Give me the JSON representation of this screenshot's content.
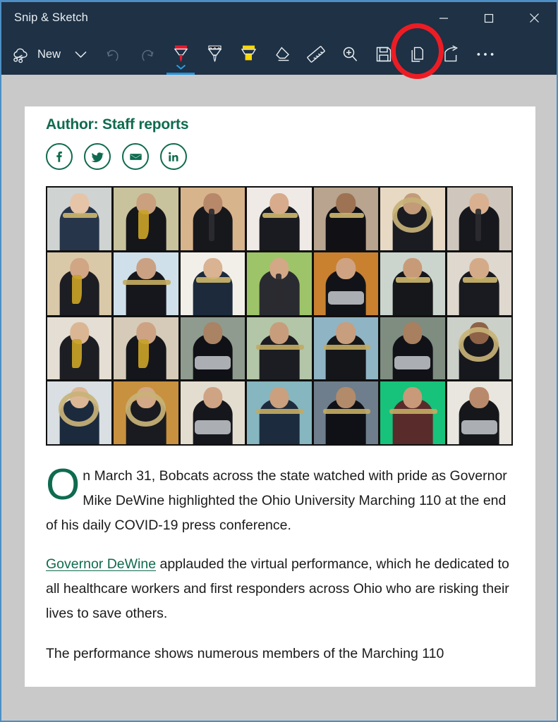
{
  "window": {
    "title": "Snip & Sketch",
    "controls": [
      {
        "name": "minimize",
        "label": "–"
      },
      {
        "name": "maximize",
        "label": "□"
      },
      {
        "name": "close",
        "label": "✕"
      }
    ],
    "accent_border_color": "#4d8fc4",
    "chrome_color": "#1e3145"
  },
  "toolbar": {
    "new_label": "New",
    "new_icon": "snip-scissors-cloud-icon",
    "new_dropdown_icon": "chevron-down-icon",
    "tools": [
      {
        "name": "undo",
        "icon": "undo-arrow-icon",
        "enabled": false,
        "selected": false
      },
      {
        "name": "redo",
        "icon": "redo-arrow-icon",
        "enabled": false,
        "selected": false
      },
      {
        "name": "ballpoint-pen",
        "icon": "ballpoint-pen-icon",
        "enabled": true,
        "selected": true,
        "color": "#e8192c"
      },
      {
        "name": "pencil",
        "icon": "pencil-icon",
        "enabled": true,
        "selected": false,
        "color": "#1b1b1b"
      },
      {
        "name": "highlighter",
        "icon": "highlighter-icon",
        "enabled": true,
        "selected": false,
        "color": "#ffd800"
      },
      {
        "name": "eraser",
        "icon": "eraser-icon",
        "enabled": true,
        "selected": false
      },
      {
        "name": "ruler",
        "icon": "ruler-icon",
        "enabled": true,
        "selected": false
      },
      {
        "name": "crop",
        "icon": "magnifier-plus-icon",
        "enabled": true,
        "selected": false
      },
      {
        "name": "save",
        "icon": "floppy-disk-save-icon",
        "enabled": true,
        "selected": false,
        "highlighted": true
      },
      {
        "name": "copy",
        "icon": "copy-pages-icon",
        "enabled": true,
        "selected": false
      },
      {
        "name": "share",
        "icon": "share-arrow-icon",
        "enabled": true,
        "selected": false
      },
      {
        "name": "see-more",
        "icon": "ellipsis-icon",
        "enabled": true,
        "selected": false
      }
    ],
    "selection_accent_color": "#2095e0"
  },
  "annotation": {
    "shape": "ellipse",
    "color": "#ed1c24",
    "targets": "save-button"
  },
  "canvas": {
    "background_color": "#c9c9c9"
  },
  "snip": {
    "author_line": "Author: Staff reports",
    "brand_color": "#0f6b4f",
    "social_buttons": [
      {
        "name": "facebook",
        "icon": "facebook-icon",
        "label": "f"
      },
      {
        "name": "twitter",
        "icon": "twitter-bird-icon",
        "label": "t"
      },
      {
        "name": "email",
        "icon": "envelope-icon",
        "label": "e"
      },
      {
        "name": "linkedin",
        "icon": "linkedin-icon",
        "label": "in"
      }
    ],
    "photo_grid": {
      "name": "marching-110-virtual-performance-grid",
      "rows": 4,
      "columns": 7,
      "cells": [
        {
          "bg": "#cfd3d2",
          "skin": "#e6c4a8",
          "shirt": "#27354a",
          "instrument": "trumpet",
          "ix": 1
        },
        {
          "bg": "#c8c39c",
          "skin": "#caa07e",
          "shirt": "#15161a",
          "instrument": "saxophone",
          "ix": 2
        },
        {
          "bg": "#d8b48c",
          "skin": "#b8886a",
          "shirt": "#17181c",
          "instrument": "clarinet",
          "ix": 3
        },
        {
          "bg": "#efeae6",
          "skin": "#d7ab8b",
          "shirt": "#1a1b20",
          "instrument": "mellophone",
          "ix": 4
        },
        {
          "bg": "#b8a48f",
          "skin": "#9d7354",
          "shirt": "#101015",
          "instrument": "trumpet",
          "ix": 5
        },
        {
          "bg": "#e7d9c4",
          "skin": "#c39b79",
          "shirt": "#1b1c21",
          "instrument": "sousaphone",
          "ix": 6
        },
        {
          "bg": "#cfc7bd",
          "skin": "#d9b190",
          "shirt": "#17181d",
          "instrument": "clarinet",
          "ix": 7
        },
        {
          "bg": "#d9c9a8",
          "skin": "#d1a684",
          "shirt": "#1d1e23",
          "instrument": "saxophone",
          "ix": 8
        },
        {
          "bg": "#cfe0ea",
          "skin": "#caa183",
          "shirt": "#16171c",
          "instrument": "trombone",
          "ix": 9
        },
        {
          "bg": "#f2efe9",
          "skin": "#d9b392",
          "shirt": "#1c2a3c",
          "instrument": "trumpet",
          "ix": 10
        },
        {
          "bg": "#9ec469",
          "skin": "#d2a887",
          "shirt": "#2a2b30",
          "instrument": "clarinet",
          "ix": 11
        },
        {
          "bg": "#c9812f",
          "skin": "#cfa382",
          "shirt": "#121318",
          "instrument": "drums",
          "ix": 12
        },
        {
          "bg": "#cbd5cd",
          "skin": "#c89b78",
          "shirt": "#16171b",
          "instrument": "trumpet",
          "ix": 13
        },
        {
          "bg": "#dfd8ce",
          "skin": "#d4ab89",
          "shirt": "#1a1b20",
          "instrument": "trumpet",
          "ix": 14
        },
        {
          "bg": "#e4ded4",
          "skin": "#dbb695",
          "shirt": "#1d1e24",
          "instrument": "saxophone",
          "ix": 15
        },
        {
          "bg": "#d5cbb8",
          "skin": "#cda384",
          "shirt": "#15161b",
          "instrument": "saxophone",
          "ix": 16
        },
        {
          "bg": "#8f9b8e",
          "skin": "#a98364",
          "shirt": "#101116",
          "instrument": "drums",
          "ix": 17
        },
        {
          "bg": "#b3c6a8",
          "skin": "#c89d7b",
          "shirt": "#1c1d22",
          "instrument": "trombone",
          "ix": 18
        },
        {
          "bg": "#8fb4c4",
          "skin": "#c79e7e",
          "shirt": "#15161a",
          "instrument": "trombone",
          "ix": 19
        },
        {
          "bg": "#7e8d80",
          "skin": "#a87f5f",
          "shirt": "#111217",
          "instrument": "drums",
          "ix": 20
        },
        {
          "bg": "#cbd0c9",
          "skin": "#8d6246",
          "shirt": "#17181d",
          "instrument": "sousaphone",
          "ix": 21
        },
        {
          "bg": "#d9dfe2",
          "skin": "#dcb795",
          "shirt": "#1b2a3d",
          "instrument": "sousaphone",
          "ix": 22
        },
        {
          "bg": "#c8913f",
          "skin": "#d2a886",
          "shirt": "#1a1b20",
          "instrument": "tuba",
          "ix": 23
        },
        {
          "bg": "#e3ddd0",
          "skin": "#cfa484",
          "shirt": "#16171c",
          "instrument": "drums",
          "ix": 24
        },
        {
          "bg": "#86b6bf",
          "skin": "#caa07f",
          "shirt": "#1d2b3e",
          "instrument": "trombone",
          "ix": 25
        },
        {
          "bg": "#6e7e8c",
          "skin": "#b28b6b",
          "shirt": "#101116",
          "instrument": "trombone",
          "ix": 26
        },
        {
          "bg": "#17c27a",
          "skin": "#c89a79",
          "shirt": "#5a2b2b",
          "instrument": "trombone",
          "ix": 27
        },
        {
          "bg": "#e9e6df",
          "skin": "#b88a6b",
          "shirt": "#16171b",
          "instrument": "drums",
          "ix": 28
        }
      ]
    },
    "paragraph_1_dropcap": "O",
    "paragraph_1": "n March 31, Bobcats across the state watched with pride as Governor Mike DeWine highlighted the Ohio University Marching 110 at the end of his daily COVID-19 press conference.",
    "paragraph_2_link": "Governor DeWine",
    "paragraph_2_rest": " applauded the virtual performance, which he dedicated to all healthcare workers and first responders across Ohio who are risking their lives to save others.",
    "paragraph_3": "The performance shows numerous members of the Marching 110"
  }
}
